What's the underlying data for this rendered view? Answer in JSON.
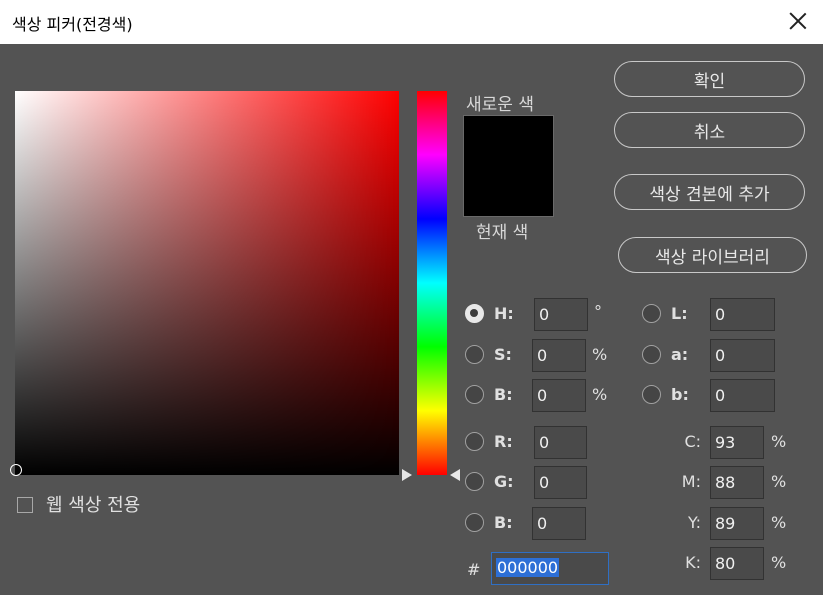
{
  "window": {
    "title": "색상 피커(전경색)"
  },
  "preview": {
    "new_label": "새로운 색",
    "current_label": "현재 색",
    "new_color": "#000000",
    "current_color": "#000000"
  },
  "buttons": {
    "ok": "확인",
    "cancel": "취소",
    "add_swatch": "색상 견본에 추가",
    "libraries": "색상 라이브러리"
  },
  "web_colors": {
    "label": "웹 색상 전용",
    "checked": false
  },
  "hsb": {
    "h": {
      "label": "H:",
      "value": "0",
      "unit": "°",
      "selected": true
    },
    "s": {
      "label": "S:",
      "value": "0",
      "unit": "%"
    },
    "b": {
      "label": "B:",
      "value": "0",
      "unit": "%"
    }
  },
  "rgb": {
    "r": {
      "label": "R:",
      "value": "0"
    },
    "g": {
      "label": "G:",
      "value": "0"
    },
    "b": {
      "label": "B:",
      "value": "0"
    }
  },
  "lab": {
    "l": {
      "label": "L:",
      "value": "0"
    },
    "a": {
      "label": "a:",
      "value": "0"
    },
    "b": {
      "label": "b:",
      "value": "0"
    }
  },
  "cmyk": {
    "c": {
      "label": "C:",
      "value": "93",
      "unit": "%"
    },
    "m": {
      "label": "M:",
      "value": "88",
      "unit": "%"
    },
    "y": {
      "label": "Y:",
      "value": "89",
      "unit": "%"
    },
    "k": {
      "label": "K:",
      "value": "80",
      "unit": "%"
    }
  },
  "hex": {
    "label": "#",
    "value": "000000"
  },
  "colors": {
    "hue_base": "#ff0000",
    "accent": "#2d6fd6"
  }
}
